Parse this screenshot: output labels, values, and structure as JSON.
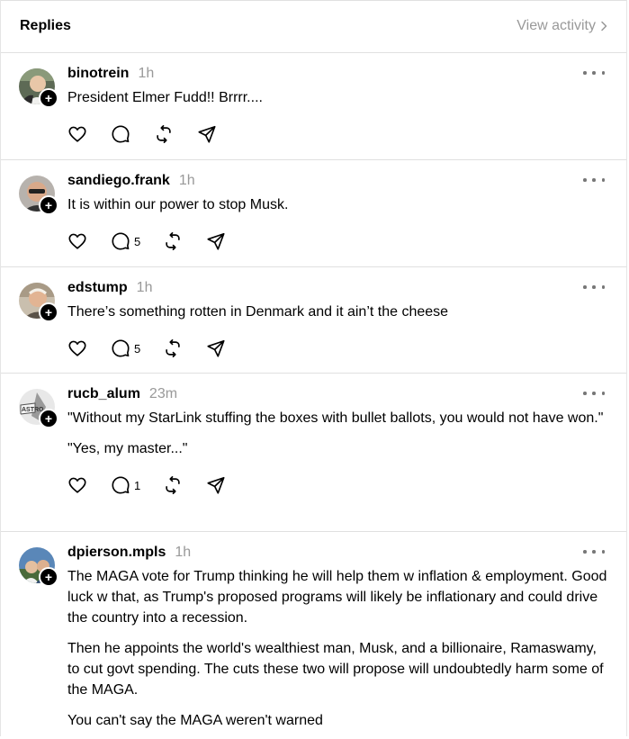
{
  "header": {
    "title": "Replies",
    "view_activity": "View activity"
  },
  "replies": [
    {
      "username": "binotrein",
      "time": "1h",
      "paragraphs": [
        "President Elmer Fudd!! Brrrr...."
      ],
      "comments": "",
      "follow": "+"
    },
    {
      "username": "sandiego.frank",
      "time": "1h",
      "paragraphs": [
        "It is within our power to stop Musk."
      ],
      "comments": "5",
      "follow": "+"
    },
    {
      "username": "edstump",
      "time": "1h",
      "paragraphs": [
        "There’s something rotten in Denmark and it ain’t the cheese"
      ],
      "comments": "5",
      "follow": "+"
    },
    {
      "username": "rucb_alum",
      "time": "23m",
      "paragraphs": [
        "\"Without my StarLink stuffing the boxes with bullet ballots, you would not have won.\"",
        "\"Yes, my master...\""
      ],
      "comments": "1",
      "follow": "+"
    },
    {
      "username": "dpierson.mpls",
      "time": "1h",
      "paragraphs": [
        "The MAGA vote for Trump thinking he will help them w inflation & employment. Good luck w that, as Trump's proposed programs will likely be inflationary and could drive the country into a recession.",
        "Then he appoints the world's wealthiest man, Musk, and a billionaire, Ramaswamy, to cut govt spending. The cuts these two will propose will undoubtedly harm some of the MAGA.",
        "You can't say the MAGA weren't warned"
      ],
      "comments": "",
      "follow": "+"
    }
  ],
  "icons": {
    "like": "heart-icon",
    "comment": "comment-icon",
    "repost": "repost-icon",
    "share": "share-icon",
    "more": "more-icon",
    "chevron": "chevron-right-icon",
    "follow": "plus-icon"
  },
  "colors": {
    "muted": "#999999",
    "divider": "#e0e0e0",
    "text": "#000000"
  }
}
